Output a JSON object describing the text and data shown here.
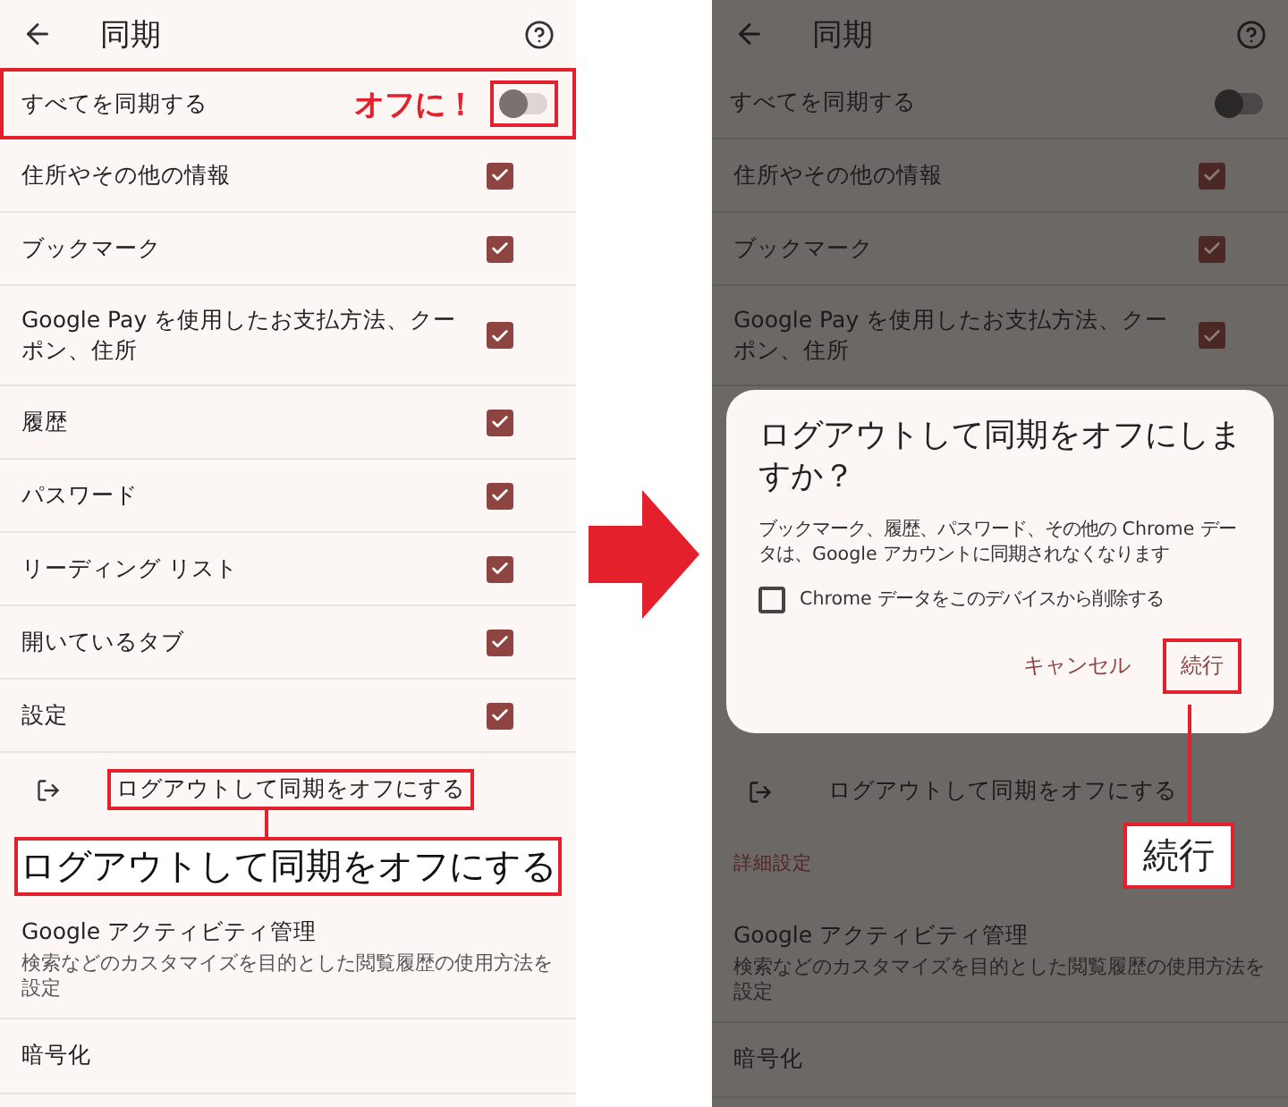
{
  "left_screen": {
    "title": "同期",
    "sync_all": {
      "label": "すべてを同期する",
      "on": false,
      "highlighted": true,
      "note": "オフに！"
    },
    "items": [
      {
        "label": "住所やその他の情報",
        "checked": true
      },
      {
        "label": "ブックマーク",
        "checked": true
      },
      {
        "label": "Google Pay を使用したお支払方法、クーポン、住所",
        "checked": true
      },
      {
        "label": "履歴",
        "checked": true
      },
      {
        "label": "パスワード",
        "checked": true
      },
      {
        "label": "リーディング リスト",
        "checked": true
      },
      {
        "label": "開いているタブ",
        "checked": true
      },
      {
        "label": "設定",
        "checked": true
      }
    ],
    "sign_out": {
      "label": "ログアウトして同期をオフにする",
      "highlighted": true
    },
    "callout": "ログアウトして同期をオフにする",
    "activity": {
      "title": "Google アクティビティ管理",
      "description": "検索などのカスタマイズを目的とした閲覧履歴の使用方法を設定"
    },
    "encryption": "暗号化"
  },
  "right_screen": {
    "title": "同期",
    "sync_all": {
      "label": "すべてを同期する",
      "on": false,
      "highlighted": false
    },
    "items": [
      {
        "label": "住所やその他の情報",
        "checked": true
      },
      {
        "label": "ブックマーク",
        "checked": true
      },
      {
        "label": "Google Pay を使用したお支払方法、クーポン、住所",
        "checked": true
      }
    ],
    "dialog": {
      "title": "ログアウトして同期をオフにしますか？",
      "message": "ブックマーク、履歴、パスワード、その他の Chrome データは、Google アカウントに同期されなくなります",
      "checkbox": {
        "label": "Chrome データをこのデバイスから削除する",
        "checked": false
      },
      "buttons": [
        {
          "label": "キャンセル",
          "highlighted": false
        },
        {
          "label": "続行",
          "highlighted": true
        }
      ]
    },
    "sign_out": {
      "label": "ログアウトして同期をオフにする",
      "highlighted": false
    },
    "section_heading": "詳細設定",
    "callout": "続行",
    "activity": {
      "title": "Google アクティビティ管理",
      "description": "検索などのカスタマイズを目的とした閲覧履歴の使用方法を設定"
    },
    "encryption": "暗号化"
  }
}
